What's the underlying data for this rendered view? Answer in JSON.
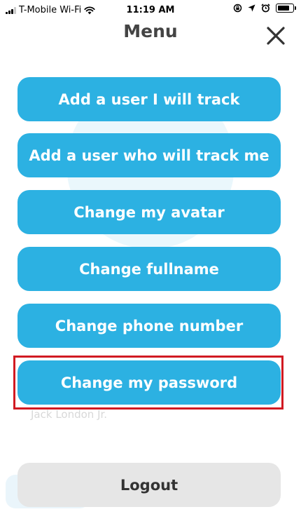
{
  "status_bar": {
    "carrier": "T-Mobile Wi-Fi",
    "time": "11:19 AM"
  },
  "header": {
    "title": "Menu",
    "close_icon": "close-icon"
  },
  "menu": {
    "items": [
      {
        "label": "Add a user I will track"
      },
      {
        "label": "Add a user who will track me"
      },
      {
        "label": "Change my avatar"
      },
      {
        "label": "Change fullname"
      },
      {
        "label": "Change phone number"
      },
      {
        "label": "Change my password",
        "highlighted": true
      }
    ],
    "logout_label": "Logout"
  },
  "background": {
    "user_name": "Jack London Jr."
  },
  "colors": {
    "button": "#2cb1e2",
    "button_text": "#ffffff",
    "logout_bg": "#e6e6e6",
    "highlight": "#d11a22"
  }
}
